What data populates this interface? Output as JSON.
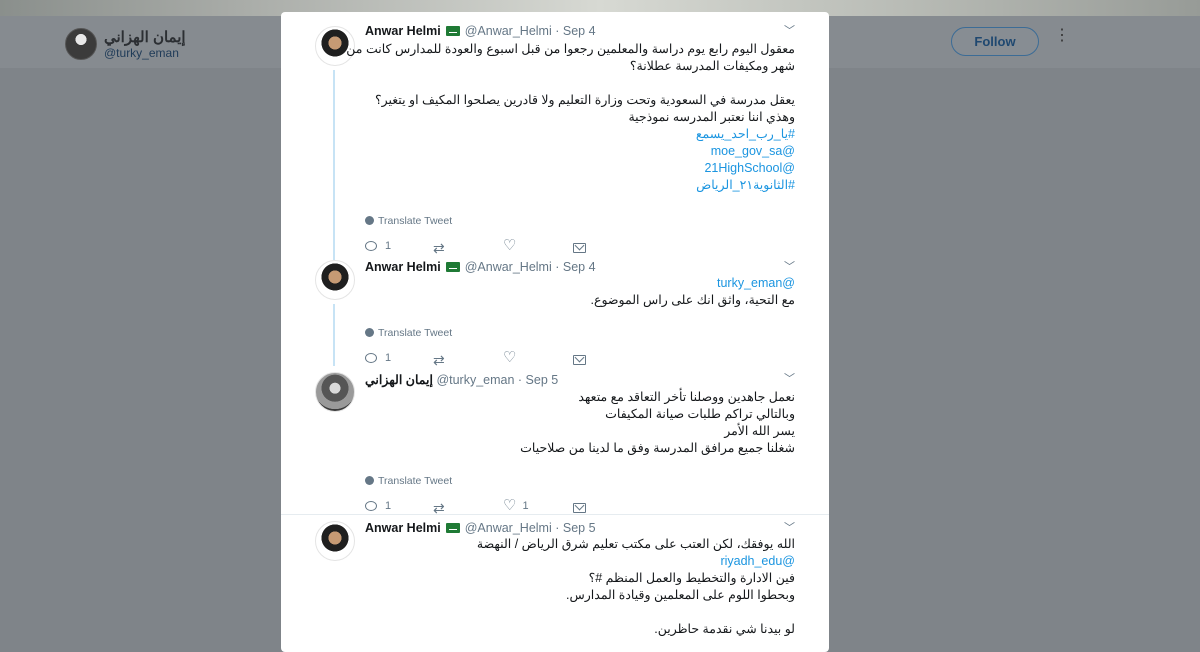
{
  "profile": {
    "name": "إيمان الهزاني",
    "handle": "@turky_eman",
    "follow_label": "Follow"
  },
  "tweets": [
    {
      "author": "Anwar Helmi",
      "handle": "@Anwar_Helmi",
      "time": "· Sep 4",
      "lines": [
        {
          "text": "معقول اليوم رابع يوم دراسة والمعلمين رجعوا من قبل اسبوع والعودة للمدارس كانت من",
          "link": false
        },
        {
          "text": "شهر ومكيفات المدرسة عطلانة؟",
          "link": false
        },
        {
          "text": "",
          "link": false
        },
        {
          "text": "يعقل مدرسة في السعودية وتحت وزارة التعليم ولا قادرين يصلحوا المكيف او يتغير؟",
          "link": false
        },
        {
          "text": "وهذي اننا نعتبر المدرسه نموذجية",
          "link": false
        },
        {
          "text": "#يا_رب_احد_يسمع",
          "link": true
        },
        {
          "text": "@moe_gov_sa",
          "link": true
        },
        {
          "text": "@21HighSchool",
          "link": true
        },
        {
          "text": "#الثانوية٢١_الرياض",
          "link": true
        }
      ],
      "translate": "Translate Tweet",
      "replies": "1",
      "likes": ""
    },
    {
      "author": "Anwar Helmi",
      "handle": "@Anwar_Helmi",
      "time": "· Sep 4",
      "lines": [
        {
          "text": "@turky_eman",
          "link": true
        },
        {
          "text": "مع التحية، واثق انك على راس الموضوع.",
          "link": false
        }
      ],
      "translate": "Translate Tweet",
      "replies": "1",
      "likes": ""
    },
    {
      "author": "إيمان الهزاني",
      "handle": "@turky_eman",
      "time": "· Sep 5",
      "lines": [
        {
          "text": "نعمل جاهدين ووصلنا تأخر التعاقد مع متعهد",
          "link": false
        },
        {
          "text": "وبالتالي تراكم طلبات صيانة المكيفات",
          "link": false
        },
        {
          "text": "يسر الله الأمر",
          "link": false
        },
        {
          "text": "شغلنا جميع مرافق المدرسة وفق ما لدينا من صلاحيات",
          "link": false
        }
      ],
      "translate": "Translate Tweet",
      "replies": "1",
      "likes": "1"
    },
    {
      "author": "Anwar Helmi",
      "handle": "@Anwar_Helmi",
      "time": "· Sep 5",
      "lines": [
        {
          "text": "الله يوفقك، لكن العتب على مكتب تعليم شرق الرياض / النهضة",
          "link": false
        },
        {
          "text": "@riyadh_edu",
          "link": true
        },
        {
          "text": "فين الادارة والتخطيط والعمل المنظم #؟",
          "link": false
        },
        {
          "text": "وبحطوا اللوم على المعلمين وقيادة المدارس.",
          "link": false
        },
        {
          "text": "",
          "link": false
        },
        {
          "text": "لو بيدنا شي نقدمة حاظرين.",
          "link": false
        }
      ]
    }
  ]
}
